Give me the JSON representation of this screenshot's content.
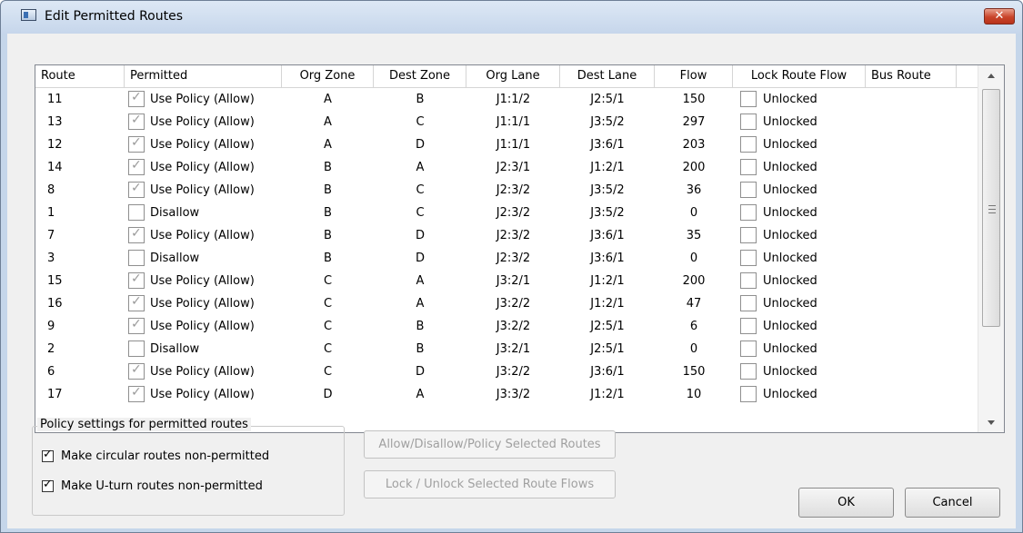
{
  "window": {
    "title": "Edit Permitted Routes",
    "close_icon": "close-icon",
    "close_glyph": "✕"
  },
  "table": {
    "columns": [
      "Route",
      "Permitted",
      "Org Zone",
      "Dest Zone",
      "Org Lane",
      "Dest Lane",
      "Flow",
      "Lock Route Flow",
      "Bus Route"
    ],
    "rows": [
      {
        "route": "11",
        "permitted_checked": true,
        "permitted": "Use Policy (Allow)",
        "org_zone": "A",
        "dest_zone": "B",
        "org_lane": "J1:1/2",
        "dest_lane": "J2:5/1",
        "flow": "150",
        "lock_checked": false,
        "lock": "Unlocked",
        "bus": ""
      },
      {
        "route": "13",
        "permitted_checked": true,
        "permitted": "Use Policy (Allow)",
        "org_zone": "A",
        "dest_zone": "C",
        "org_lane": "J1:1/1",
        "dest_lane": "J3:5/2",
        "flow": "297",
        "lock_checked": false,
        "lock": "Unlocked",
        "bus": ""
      },
      {
        "route": "12",
        "permitted_checked": true,
        "permitted": "Use Policy (Allow)",
        "org_zone": "A",
        "dest_zone": "D",
        "org_lane": "J1:1/1",
        "dest_lane": "J3:6/1",
        "flow": "203",
        "lock_checked": false,
        "lock": "Unlocked",
        "bus": ""
      },
      {
        "route": "14",
        "permitted_checked": true,
        "permitted": "Use Policy (Allow)",
        "org_zone": "B",
        "dest_zone": "A",
        "org_lane": "J2:3/1",
        "dest_lane": "J1:2/1",
        "flow": "200",
        "lock_checked": false,
        "lock": "Unlocked",
        "bus": ""
      },
      {
        "route": "8",
        "permitted_checked": true,
        "permitted": "Use Policy (Allow)",
        "org_zone": "B",
        "dest_zone": "C",
        "org_lane": "J2:3/2",
        "dest_lane": "J3:5/2",
        "flow": "36",
        "lock_checked": false,
        "lock": "Unlocked",
        "bus": ""
      },
      {
        "route": "1",
        "permitted_checked": false,
        "permitted": "Disallow",
        "org_zone": "B",
        "dest_zone": "C",
        "org_lane": "J2:3/2",
        "dest_lane": "J3:5/2",
        "flow": "0",
        "lock_checked": false,
        "lock": "Unlocked",
        "bus": ""
      },
      {
        "route": "7",
        "permitted_checked": true,
        "permitted": "Use Policy (Allow)",
        "org_zone": "B",
        "dest_zone": "D",
        "org_lane": "J2:3/2",
        "dest_lane": "J3:6/1",
        "flow": "35",
        "lock_checked": false,
        "lock": "Unlocked",
        "bus": ""
      },
      {
        "route": "3",
        "permitted_checked": false,
        "permitted": "Disallow",
        "org_zone": "B",
        "dest_zone": "D",
        "org_lane": "J2:3/2",
        "dest_lane": "J3:6/1",
        "flow": "0",
        "lock_checked": false,
        "lock": "Unlocked",
        "bus": ""
      },
      {
        "route": "15",
        "permitted_checked": true,
        "permitted": "Use Policy (Allow)",
        "org_zone": "C",
        "dest_zone": "A",
        "org_lane": "J3:2/1",
        "dest_lane": "J1:2/1",
        "flow": "200",
        "lock_checked": false,
        "lock": "Unlocked",
        "bus": ""
      },
      {
        "route": "16",
        "permitted_checked": true,
        "permitted": "Use Policy (Allow)",
        "org_zone": "C",
        "dest_zone": "A",
        "org_lane": "J3:2/2",
        "dest_lane": "J1:2/1",
        "flow": "47",
        "lock_checked": false,
        "lock": "Unlocked",
        "bus": ""
      },
      {
        "route": "9",
        "permitted_checked": true,
        "permitted": "Use Policy (Allow)",
        "org_zone": "C",
        "dest_zone": "B",
        "org_lane": "J3:2/2",
        "dest_lane": "J2:5/1",
        "flow": "6",
        "lock_checked": false,
        "lock": "Unlocked",
        "bus": ""
      },
      {
        "route": "2",
        "permitted_checked": false,
        "permitted": "Disallow",
        "org_zone": "C",
        "dest_zone": "B",
        "org_lane": "J3:2/1",
        "dest_lane": "J2:5/1",
        "flow": "0",
        "lock_checked": false,
        "lock": "Unlocked",
        "bus": ""
      },
      {
        "route": "6",
        "permitted_checked": true,
        "permitted": "Use Policy (Allow)",
        "org_zone": "C",
        "dest_zone": "D",
        "org_lane": "J3:2/2",
        "dest_lane": "J3:6/1",
        "flow": "150",
        "lock_checked": false,
        "lock": "Unlocked",
        "bus": ""
      },
      {
        "route": "17",
        "permitted_checked": true,
        "permitted": "Use Policy (Allow)",
        "org_zone": "D",
        "dest_zone": "A",
        "org_lane": "J3:3/2",
        "dest_lane": "J1:2/1",
        "flow": "10",
        "lock_checked": false,
        "lock": "Unlocked",
        "bus": ""
      }
    ]
  },
  "policy": {
    "legend": "Policy settings for permitted routes",
    "options": [
      {
        "label": "Make circular routes non-permitted",
        "checked": true
      },
      {
        "label": "Make U-turn routes non-permitted",
        "checked": true
      }
    ]
  },
  "actions": {
    "allow_disallow_label": "Allow/Disallow/Policy Selected Routes",
    "lock_unlock_label": "Lock / Unlock Selected Route Flows",
    "ok_label": "OK",
    "cancel_label": "Cancel"
  },
  "colors": {
    "title_bar": "#c6d6eb",
    "close_button": "#c9442a",
    "dialog_background": "#f0f0f0"
  }
}
